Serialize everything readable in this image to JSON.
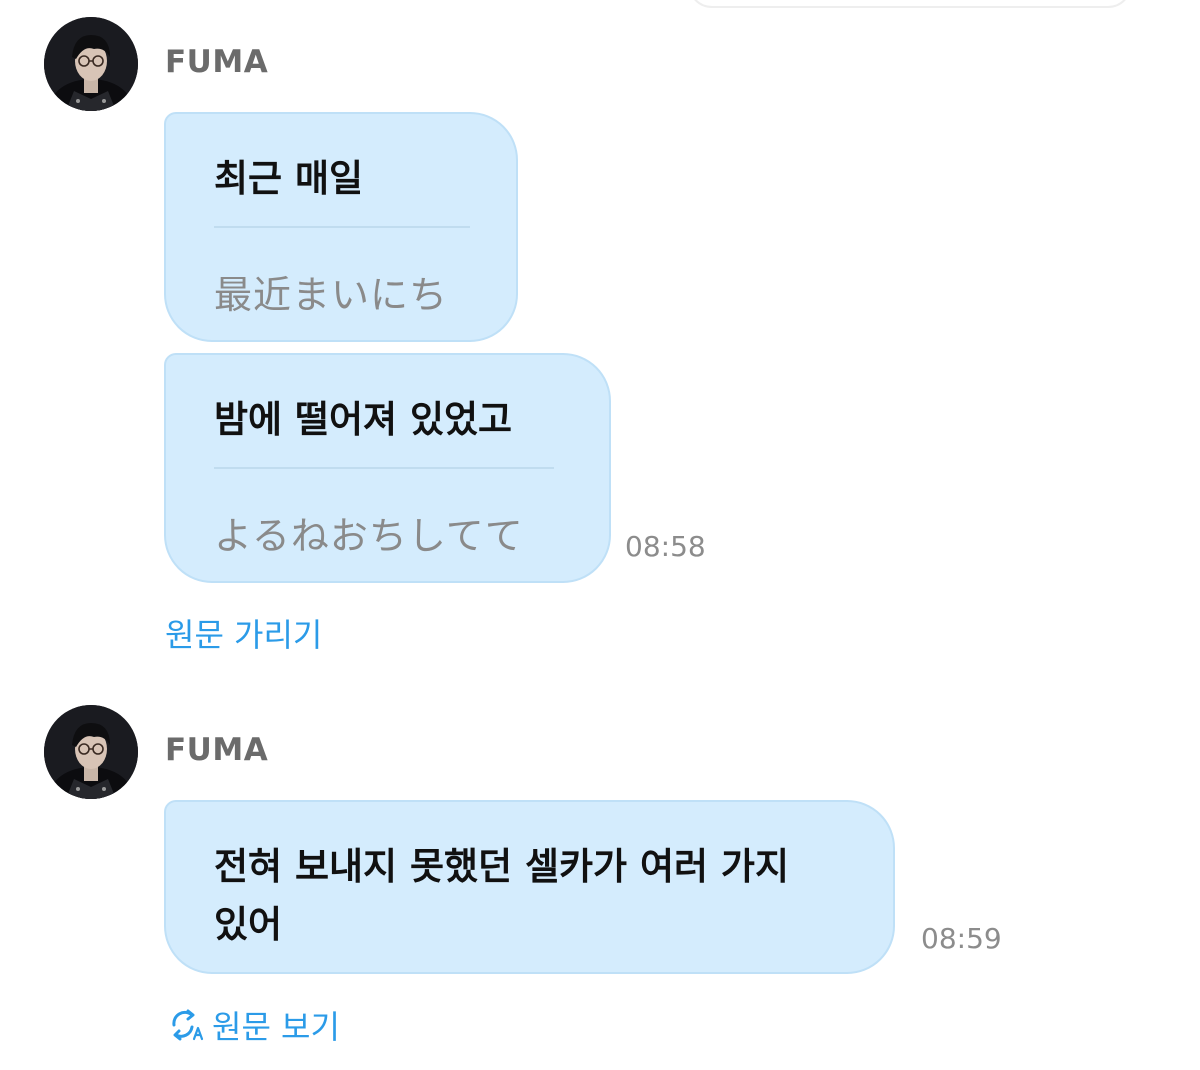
{
  "colors": {
    "bubble_bg": "#d4ecfd",
    "bubble_border": "#bfe0f7",
    "link": "#2b9be8",
    "timestamp": "#8c8c8c",
    "sender_name": "#6b6b6b"
  },
  "messages": [
    {
      "sender": "FUMA",
      "bubbles": [
        {
          "text": "최근 매일",
          "original": "最近まいにち"
        },
        {
          "text": "밤에 떨어져 있었고",
          "original": "よるねおちしてて"
        }
      ],
      "time": "08:58",
      "toggle_label": "원문 가리기"
    },
    {
      "sender": "FUMA",
      "bubbles": [
        {
          "text_lines": [
            "전혀 보내지 못했던 셀카가 여러 가지",
            "있어"
          ]
        }
      ],
      "time": "08:59",
      "toggle_label": "원문 보기",
      "toggle_icon": "translate-icon"
    }
  ]
}
